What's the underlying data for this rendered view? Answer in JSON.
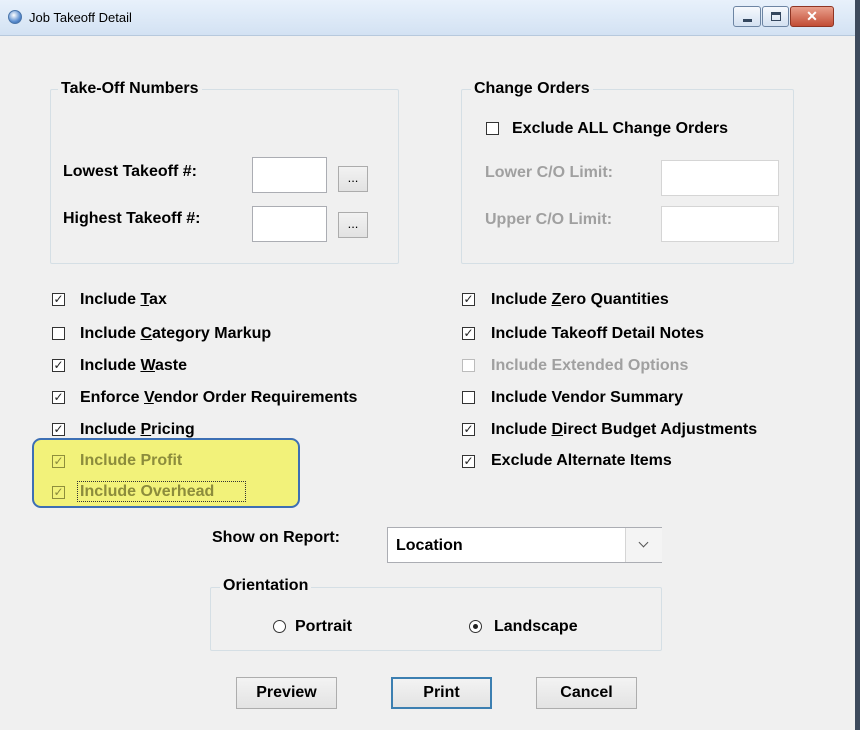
{
  "window": {
    "title": "Job Takeoff Detail",
    "close_glyph": "✕"
  },
  "takeoff_numbers": {
    "legend": "Take-Off Numbers",
    "lowest_label": "Lowest Takeoff #:",
    "highest_label": "Highest Takeoff #:",
    "lowest_value": "",
    "highest_value": "",
    "browse_label": "..."
  },
  "change_orders": {
    "legend": "Change Orders",
    "exclude_all_label": "Exclude ALL Change Orders",
    "exclude_all_checked": false,
    "lower_label": "Lower C/O Limit:",
    "upper_label": "Upper C/O Limit:",
    "lower_value": "",
    "upper_value": ""
  },
  "checkboxes_left": [
    {
      "pre": "Include ",
      "key": "T",
      "post": "ax",
      "checked": true,
      "mark": "✓"
    },
    {
      "pre": "Include ",
      "key": "C",
      "post": "ategory Markup",
      "checked": false,
      "mark": ""
    },
    {
      "pre": "Include ",
      "key": "W",
      "post": "aste",
      "checked": true,
      "mark": "✓"
    },
    {
      "pre": "Enforce ",
      "key": "V",
      "post": "endor Order Requirements",
      "checked": true,
      "mark": "✓"
    },
    {
      "pre": "Include ",
      "key": "P",
      "post": "ricing",
      "checked": true,
      "mark": "✓"
    },
    {
      "pre": "Include Profit",
      "key": "",
      "post": "",
      "checked": true,
      "mark": "✓"
    },
    {
      "pre": "Include Overhead",
      "key": "",
      "post": "",
      "checked": true,
      "mark": "✓"
    }
  ],
  "checkboxes_right": [
    {
      "pre": "Include ",
      "key": "Z",
      "post": "ero Quantities",
      "checked": true,
      "mark": "✓"
    },
    {
      "pre": "Include Takeoff Detail Notes",
      "key": "",
      "post": "",
      "checked": true,
      "mark": "✓"
    },
    {
      "pre": "Include Extended Options",
      "key": "",
      "post": "",
      "checked": false,
      "mark": ""
    },
    {
      "pre": "Include Vendor Summary",
      "key": "",
      "post": "",
      "checked": false,
      "mark": ""
    },
    {
      "pre": "Include ",
      "key": "D",
      "post": "irect Budget Adjustments",
      "checked": true,
      "mark": "✓"
    },
    {
      "pre": "Exclude Alternate Items",
      "key": "",
      "post": "",
      "checked": true,
      "mark": "✓"
    }
  ],
  "show_on_report": {
    "label": "Show on Report:",
    "value": "Location"
  },
  "orientation": {
    "legend": "Orientation",
    "portrait_label": "Portrait",
    "landscape_label": "Landscape",
    "selected": "Landscape"
  },
  "buttons": {
    "preview": "Preview",
    "print": "Print",
    "cancel": "Cancel"
  },
  "colors": {
    "highlight": "#f2f27a",
    "highlight_border": "#3d6fb4",
    "default_button_border": "#3c7fb1"
  }
}
